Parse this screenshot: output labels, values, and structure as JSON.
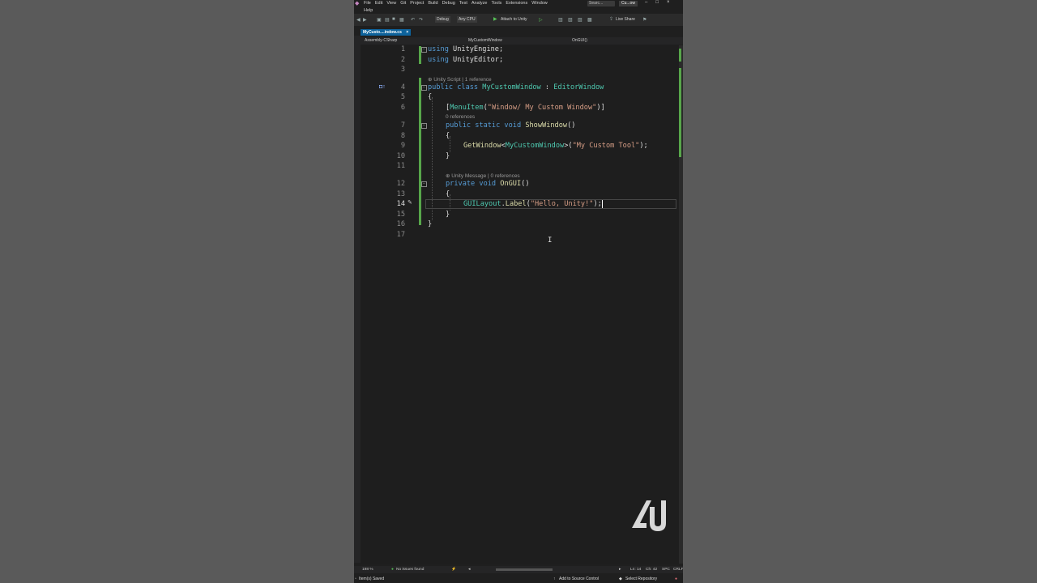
{
  "menubar": {
    "items": [
      "File",
      "Edit",
      "View",
      "Git",
      "Project",
      "Build",
      "Debug",
      "Test",
      "Analyze",
      "Tools",
      "Extensions",
      "Window"
    ],
    "help": "Help",
    "search": "Searc...",
    "solution": "Cu...ow"
  },
  "toolbar": {
    "config": "Debug",
    "platform": "Any CPU",
    "attach": "Attach to Unity",
    "live_share": "Live Share"
  },
  "tabs": {
    "active": "MyCusto....indow.cs",
    "close": "×"
  },
  "navbar": {
    "project": "Assembly-CSharp",
    "type": "MyCustomWindow",
    "member": "OnGUI()"
  },
  "code": {
    "line_numbers": [
      "1",
      "2",
      "3",
      "4",
      "5",
      "6",
      "7",
      "8",
      "9",
      "10",
      "11",
      "12",
      "13",
      "14",
      "15",
      "16",
      "17"
    ],
    "lens_class": "Unity Script | 1 reference",
    "lens_showwindow": "0 references",
    "lens_ongui": "Unity Message | 0 references",
    "l1": {
      "kw": "using",
      "rest": " UnityEngine;"
    },
    "l2": {
      "kw": "using",
      "rest": " UnityEditor;"
    },
    "l4": {
      "kw": "public class",
      "ty": "MyCustomWindow",
      "mid": " : ",
      "base": "EditorWindow"
    },
    "l5": "{",
    "l6": {
      "open": "[",
      "attr": "MenuItem",
      "paren": "(",
      "str": "\"Window/ My Custom Window\"",
      "close": ")]"
    },
    "l7": {
      "kw": "public static void",
      "fn": "ShowWindow",
      "rest": "()"
    },
    "l8": "{",
    "l9": {
      "fn": "GetWindow",
      "lt": "<",
      "ty": "MyCustomWindow",
      "gt": ">(",
      "str": "\"My Custom Tool\"",
      "rest": ");"
    },
    "l10": "}",
    "l12": {
      "kw": "private void",
      "fn": "OnGUI",
      "rest": "()"
    },
    "l13": "{",
    "l14": {
      "ty": "GUILayout",
      "dot": ".",
      "fn": "Label",
      "paren": "(",
      "str": "\"Hello, Unity!\"",
      "rest": ");"
    },
    "l15": "}",
    "l16": "}"
  },
  "bottombar": {
    "zoom": "198 %",
    "issues": "No issues found",
    "ln": "Ln: 14",
    "ch": "Ch: 42",
    "spc": "SPC",
    "crlf": "CRLF"
  },
  "statusbar": {
    "saved": "Item(s) Saved",
    "source_control": "Add to Source Control",
    "repo": "Select Repository"
  },
  "colors": {
    "keyword": "#569cd6",
    "type": "#4ec9b0",
    "method": "#dcdcaa",
    "string": "#d69d85",
    "change_bar": "#57a64a",
    "accent": "#0e639c"
  }
}
